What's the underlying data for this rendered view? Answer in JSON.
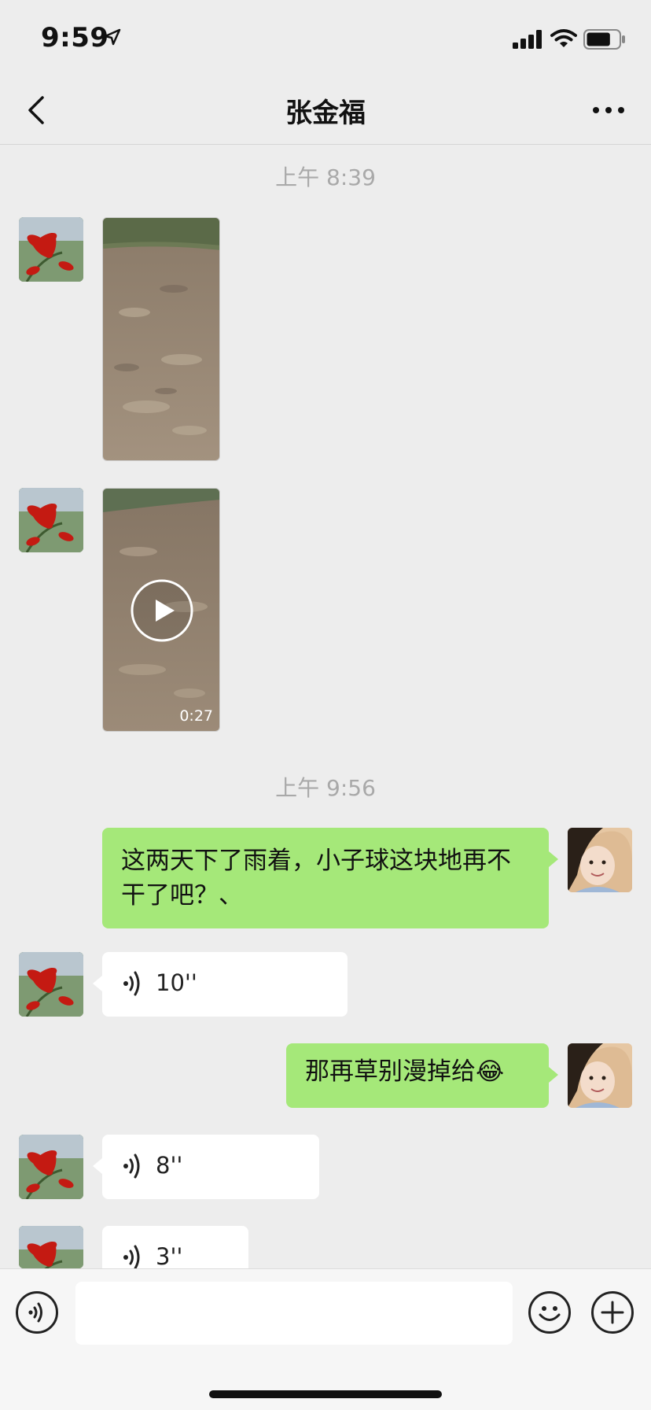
{
  "status_bar": {
    "time": "9:59",
    "battery_level": 0.75
  },
  "header": {
    "title": "张金福"
  },
  "messages": {
    "timestamp_1": "上午 8:39",
    "video_duration": "0:27",
    "timestamp_2": "上午 9:56",
    "sent_1": "这两天下了雨着，小子球这块地再不干了吧？、",
    "voice_1": "10''",
    "sent_2": "那再草别漫掉给😂",
    "voice_2": "8''",
    "voice_3": "3''"
  },
  "colors": {
    "sent_bubble": "#a5e879",
    "received_bubble": "#ffffff",
    "background": "#ededed"
  },
  "icons": [
    "location-arrow-icon",
    "signal-icon",
    "wifi-icon",
    "battery-icon",
    "back-chevron-icon",
    "more-dots-icon",
    "play-icon",
    "voice-wave-icon",
    "voice-input-icon",
    "emoji-icon",
    "plus-icon"
  ]
}
